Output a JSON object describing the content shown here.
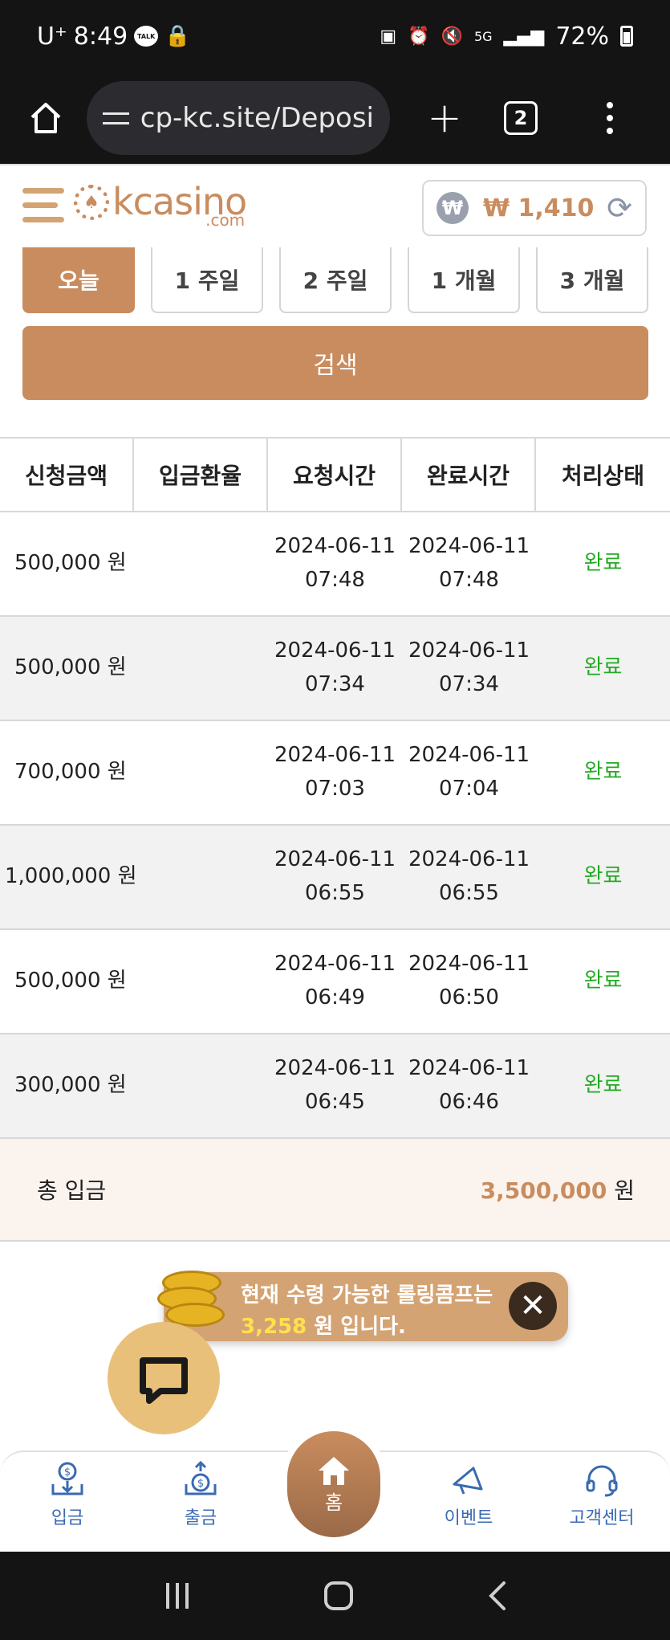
{
  "status_bar": {
    "carrier": "U⁺",
    "time": "8:49",
    "talk_badge": "TALK",
    "network": "5G",
    "battery": "72%"
  },
  "browser": {
    "url": "cp-kc.site/Deposi",
    "tab_count": "2"
  },
  "site": {
    "logo_text": "kcasino",
    "logo_sub": ".com",
    "currency_symbol": "₩",
    "balance": "₩ 1,410"
  },
  "periods": [
    "오늘",
    "1 주일",
    "2 주일",
    "1 개월",
    "3 개월"
  ],
  "search_label": "검색",
  "table": {
    "headers": [
      "신청금액",
      "입금환율",
      "요청시간",
      "완료시간",
      "처리상태"
    ],
    "rows": [
      {
        "amount": "500,000 원",
        "rate": "",
        "req_date": "2024-06-11",
        "req_time": "07:48",
        "done_date": "2024-06-11",
        "done_time": "07:48",
        "status": "완료"
      },
      {
        "amount": "500,000 원",
        "rate": "",
        "req_date": "2024-06-11",
        "req_time": "07:34",
        "done_date": "2024-06-11",
        "done_time": "07:34",
        "status": "완료"
      },
      {
        "amount": "700,000 원",
        "rate": "",
        "req_date": "2024-06-11",
        "req_time": "07:03",
        "done_date": "2024-06-11",
        "done_time": "07:04",
        "status": "완료"
      },
      {
        "amount": "1,000,000 원",
        "rate": "",
        "req_date": "2024-06-11",
        "req_time": "06:55",
        "done_date": "2024-06-11",
        "done_time": "06:55",
        "status": "완료"
      },
      {
        "amount": "500,000 원",
        "rate": "",
        "req_date": "2024-06-11",
        "req_time": "06:49",
        "done_date": "2024-06-11",
        "done_time": "06:50",
        "status": "완료"
      },
      {
        "amount": "300,000 원",
        "rate": "",
        "req_date": "2024-06-11",
        "req_time": "06:45",
        "done_date": "2024-06-11",
        "done_time": "06:46",
        "status": "완료"
      }
    ]
  },
  "total": {
    "label": "총 입금",
    "amount": "3,500,000",
    "unit": "원"
  },
  "notice": {
    "line1": "현재 수령 가능한 롤링콤프는",
    "amount": "3,258",
    "line2_suffix": "원 입니다."
  },
  "bottom_nav": {
    "deposit": "입금",
    "withdraw": "출금",
    "home": "홈",
    "event": "이벤트",
    "support": "고객센터"
  },
  "colors": {
    "brand": "#c98c5e",
    "status_done": "#22aa22",
    "nav_blue": "#3a6ab0"
  }
}
